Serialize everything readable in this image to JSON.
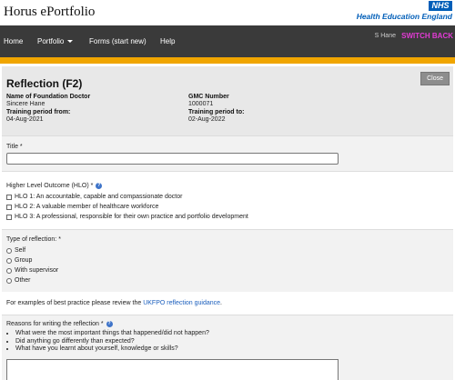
{
  "app": {
    "title": "Horus ePortfolio",
    "nhs_logo": "NHS",
    "org_name": "Health Education England"
  },
  "nav": {
    "items": [
      {
        "label": "Home"
      },
      {
        "label": "Portfolio"
      },
      {
        "label": "Forms (start new)"
      },
      {
        "label": "Help"
      }
    ],
    "user": "S Hane",
    "switch_back": "SWITCH BACK"
  },
  "form": {
    "title": "Reflection (F2)",
    "close_label": "Close",
    "doctor_label": "Name of Foundation Doctor",
    "doctor_value": "Sincere Hane",
    "gmc_label": "GMC Number",
    "gmc_value": "1000071",
    "period_from_label": "Training period from:",
    "period_from_value": "04-Aug-2021",
    "period_to_label": "Training period to:",
    "period_to_value": "02-Aug-2022"
  },
  "title_field": {
    "label": "Title",
    "required_mark": "*",
    "value": ""
  },
  "hlo": {
    "label": "Higher Level Outcome (HLO)",
    "required_mark": "*",
    "options": [
      "HLO 1: An accountable, capable and compassionate doctor",
      "HLO 2: A valuable member of healthcare workforce",
      "HLO 3: A professional, responsible for their own practice and portfolio development"
    ]
  },
  "reflection_type": {
    "label": "Type of reflection:",
    "required_mark": "*",
    "options": [
      "Self",
      "Group",
      "With supervisor",
      "Other"
    ]
  },
  "guidance": {
    "text": "For examples of best practice please review the",
    "link": "UKFPO reflection guidance",
    "suffix": "."
  },
  "reasons": {
    "label": "Reasons for writing the reflection",
    "required_mark": "*",
    "prompts": [
      "What were the most important things that happened/did not happen?",
      "Did anything go differently than expected?",
      "What have you learnt about yourself, knowledge or skills?"
    ]
  },
  "colors": {
    "nav_bg": "#3a3a3a",
    "accent_bar": "#f0a500",
    "switch_back": "#e33ad5",
    "nhs_blue": "#005eb8",
    "link": "#1a5ebd"
  },
  "icons": {
    "help": "help-circle-icon",
    "dropdown": "caret-down-icon"
  }
}
